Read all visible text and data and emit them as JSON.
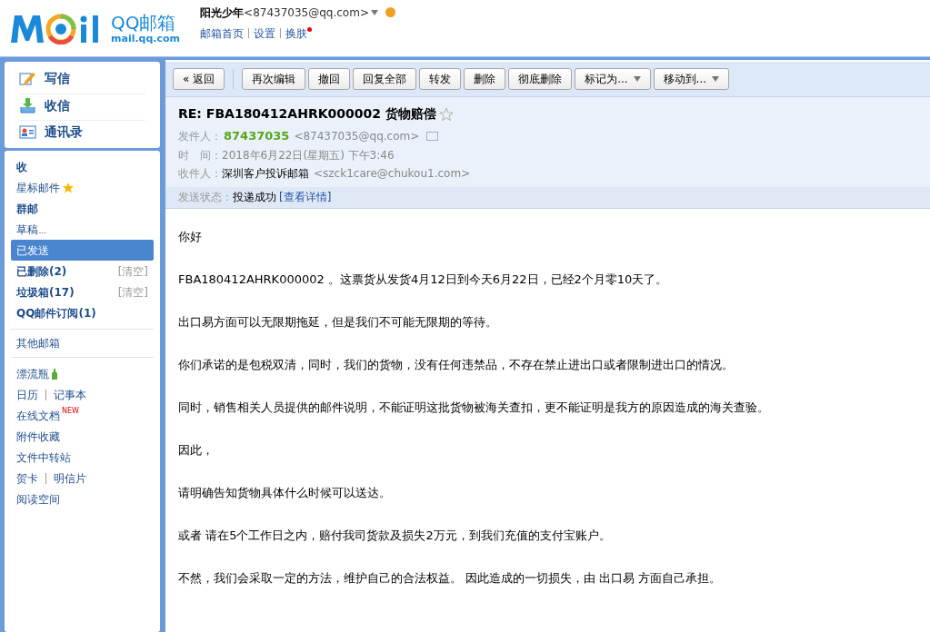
{
  "header": {
    "logo_text": "QQ邮箱",
    "logo_sub": "mail.qq.com",
    "user_name": "阳光少年",
    "user_email": "<87437035@qq.com>",
    "links": [
      "邮箱首页",
      "设置",
      "换肤"
    ]
  },
  "sidebar": {
    "actions": [
      {
        "label": "写信",
        "kind": "compose"
      },
      {
        "label": "收信",
        "kind": "inbox"
      },
      {
        "label": "通讯录",
        "kind": "contacts"
      }
    ],
    "folders": [
      {
        "label": "收",
        "bold": true,
        "selected": false
      },
      {
        "label": "星标邮件",
        "bold": false,
        "selected": false,
        "kind": "starred"
      },
      {
        "label": "群邮",
        "bold": true,
        "selected": false
      },
      {
        "label": "草稿",
        "bold": false,
        "selected": false,
        "kind": "drafts"
      },
      {
        "label": "已发送",
        "bold": false,
        "selected": true
      },
      {
        "label": "已删除(2)",
        "bold": true,
        "selected": false,
        "action": "[清空]"
      },
      {
        "label": "垃圾箱(17)",
        "bold": true,
        "selected": false,
        "action": "[清空]"
      },
      {
        "label": "QQ邮件订阅(1)",
        "bold": true,
        "selected": false
      }
    ],
    "other": "其他邮箱",
    "tools": [
      {
        "links": [
          "漂流瓶"
        ],
        "kind": "bottle"
      },
      {
        "links": [
          "日历",
          "记事本"
        ]
      },
      {
        "links": [
          "在线文档"
        ],
        "badge": "NEW"
      },
      {
        "links": [
          "附件收藏"
        ]
      },
      {
        "links": [
          "文件中转站"
        ]
      },
      {
        "links": [
          "贺卡",
          "明信片"
        ]
      },
      {
        "links": [
          "阅读空间"
        ]
      }
    ]
  },
  "toolbar": [
    {
      "label": "« 返回",
      "kind": "plain"
    },
    {
      "label": "再次编辑",
      "kind": "plain"
    },
    {
      "label": "撤回",
      "kind": "plain"
    },
    {
      "label": "回复全部",
      "kind": "plain"
    },
    {
      "label": "转发",
      "kind": "plain"
    },
    {
      "label": "删除",
      "kind": "plain"
    },
    {
      "label": "彻底删除",
      "kind": "plain"
    },
    {
      "label": "标记为...",
      "kind": "dropdown"
    },
    {
      "label": "移动到...",
      "kind": "dropdown"
    }
  ],
  "mail": {
    "subject": "RE: FBA180412AHRK000002 货物赔偿",
    "starred": false,
    "from_label": "发件人：",
    "from_name": "87437035",
    "from_email": "<87437035@qq.com>",
    "time_label": "时　间：",
    "time": "2018年6月22日(星期五) 下午3:46",
    "to_label": "收件人：",
    "to_name": "深圳客户投诉邮箱",
    "to_email": "<szck1care@chukou1.com>",
    "status_label": "发送状态：",
    "status": "投递成功",
    "status_link": "[查看详情]"
  },
  "body": [
    "你好",
    "FBA180412AHRK000002 。这票货从发货4月12日到今天6月22日，已经2个月零10天了。",
    "出口易方面可以无限期拖延，但是我们不可能无限期的等待。",
    "你们承诺的是包税双清，同时，我们的货物，没有任何违禁品，不存在禁止进出口或者限制进出口的情况。",
    "同时，销售相关人员提供的邮件说明，不能证明这批货物被海关查扣，更不能证明是我方的原因造成的海关查验。",
    "因此，",
    "请明确告知货物具体什么时候可以送达。",
    "或者 请在5个工作日之内，赔付我司货款及损失2万元，到我们充值的支付宝账户。",
    "不然，我们会采取一定的方法，维护自己的合法权益。 因此造成的一切损失，由 出口易 方面自己承担。"
  ]
}
